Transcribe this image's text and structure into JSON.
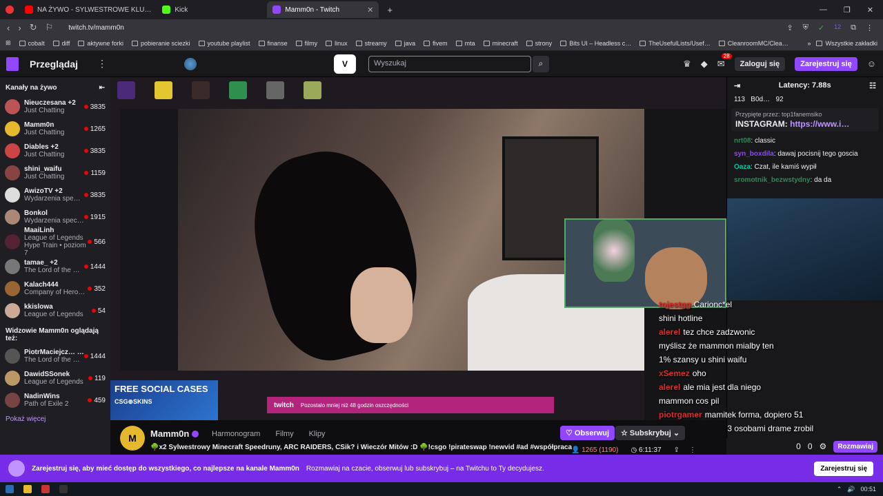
{
  "browser": {
    "tabs": [
      {
        "label": "NA ŻYWO - SYLWESTROWE KLU…",
        "color": "#ff0000"
      },
      {
        "label": "Kick",
        "color": "#53fc18"
      },
      {
        "label": "Mamm0n - Twitch",
        "color": "#9147ff"
      }
    ],
    "url": "twitch.tv/mamm0n",
    "bookmarks": [
      "cobalt",
      "diff",
      "aktywne forki",
      "pobieranie sciezki",
      "youtube playlist",
      "finanse",
      "filmy",
      "linux",
      "streamy",
      "java",
      "fivem",
      "mta",
      "minecraft",
      "strony",
      "Bits UI – Headless c…",
      "TheUsefulLists/Usef…",
      "CleanroomMC/Clea…"
    ],
    "all_bookmarks": "Wszystkie zakładki",
    "ext_badge": "12"
  },
  "topnav": {
    "browse": "Przeglądaj",
    "search_placeholder": "Wyszukaj",
    "notif_count": "28",
    "login": "Zaloguj się",
    "signup": "Zarejestruj się"
  },
  "sidebar": {
    "live_heading": "Kanały na żywo",
    "channels": [
      {
        "name": "Nieuczesana +2",
        "game": "Just Chatting",
        "viewers": "3835",
        "color": "#b55"
      },
      {
        "name": "Mamm0n",
        "game": "Just Chatting",
        "viewers": "1265",
        "color": "#e5b82e"
      },
      {
        "name": "Diables +2",
        "game": "Just Chatting",
        "viewers": "3835",
        "color": "#c44"
      },
      {
        "name": "shini_waifu",
        "game": "Just Chatting",
        "viewers": "1159",
        "color": "#844"
      },
      {
        "name": "AwizoTV +2",
        "game": "Wydarzenia spe…",
        "viewers": "3835",
        "color": "#ddd"
      },
      {
        "name": "Bonkol",
        "game": "Wydarzenia spec…",
        "viewers": "1915",
        "color": "#a87"
      },
      {
        "name": "MaaiLinh",
        "game": "League of Legends",
        "viewers": "566",
        "color": "#523",
        "extra": "Hype Train • poziom 7"
      },
      {
        "name": "tamae_ +2",
        "game": "The Lord of the …",
        "viewers": "1444",
        "color": "#777"
      },
      {
        "name": "Kalach444",
        "game": "Company of Hero…",
        "viewers": "352",
        "color": "#963"
      },
      {
        "name": "kkislowa",
        "game": "League of Legends",
        "viewers": "54",
        "color": "#ca9"
      }
    ],
    "also_heading": "Widzowie Mamm0n oglądają też:",
    "also": [
      {
        "name": "PiotrMaciejcz… +2",
        "game": "The Lord of the …",
        "viewers": "1444",
        "color": "#555"
      },
      {
        "name": "DawidSSonek",
        "game": "League of Legends",
        "viewers": "119",
        "color": "#b96"
      },
      {
        "name": "NadinWins",
        "game": "Path of Exile 2",
        "viewers": "459",
        "color": "#744"
      }
    ],
    "more": "Pokaż więcej"
  },
  "video": {
    "promo_title": "FREE SOCIAL CASES",
    "promo_brand": "CSG⊕SKINS",
    "banner_brand": "twitch",
    "banner_text": "Pozostało mniej niż 48 godzin oszczędności"
  },
  "chat": {
    "latency": "Latency: 7.88s",
    "counts": [
      "113",
      "B0d…",
      "92"
    ],
    "pinned_by": "Przypięte przez: top1fanemsiko",
    "pinned_text": "INSTAGRAM: ",
    "pinned_link": "https://www.i…",
    "messages": [
      {
        "user": "nrt08",
        "text": "classic",
        "color": "#2e8b57"
      },
      {
        "user": "syn_boxdila",
        "text": "dawaj pocisnij tego goscia",
        "color": "#9147ff"
      },
      {
        "user": "Oaza",
        "text": "Czat, ile kamiś wypił",
        "color": "#00c8a0"
      },
      {
        "user": "sromotnik_bezwstydny",
        "text": "da da",
        "color": "#2e8b57"
      }
    ],
    "overlay": [
      {
        "user": "tojestgg",
        "text": "Carionc*el"
      },
      {
        "user": "",
        "text": "shini hotline"
      },
      {
        "user": "alerel",
        "text": "tez chce zadzwonic"
      },
      {
        "user": "",
        "text": "myślisz że mammon mialby ten"
      },
      {
        "user": "",
        "text": "1% szansy u shini waifu"
      },
      {
        "user": "xSemez",
        "text": "oho"
      },
      {
        "user": "alerel",
        "text": "ale mia jest dla niego"
      },
      {
        "user": "",
        "text": "mammon cos pil"
      },
      {
        "user": "piotrgamer",
        "text": "mamitek forma, dopiero 51"
      },
      {
        "user": "",
        "text": "po północy a już z 3 osobami drame zrobil"
      }
    ],
    "chat_button": "Rozmawiaj",
    "zero1": "0",
    "zero2": "0"
  },
  "stream": {
    "channel": "Mamm0n",
    "tabs": [
      "Harmonogram",
      "Filmy",
      "Klipy"
    ],
    "title": "🌳x2 Sylwestrowy Minecraft Speedruny, ARC RAIDERS, CSik? i Wieczór Mitów :D 🌳!csgo !pirateswap !newvid #ad #współpraca",
    "follow": "Obserwuj",
    "subscribe": "Subskrybuj",
    "viewers": "1265 (1190)",
    "uptime": "6:11:37"
  },
  "signup_bar": {
    "text_bold": "Zarejestruj się, aby mieć dostęp do wszystkiego, co najlepsze na kanale Mamm0n",
    "text": "Rozmawiaj na czacie, obserwuj lub subskrybuj – na Twitchu to Ty decydujesz.",
    "button": "Zarejestruj się"
  },
  "taskbar": {
    "time": "00:51"
  }
}
